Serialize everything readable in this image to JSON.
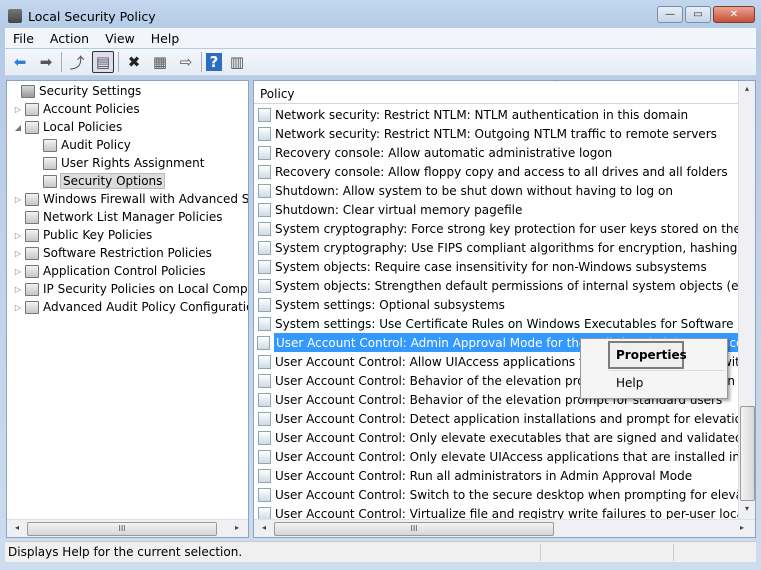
{
  "window": {
    "title": "Local Security Policy",
    "minimize": "—",
    "maximize": "▭",
    "close": "✕"
  },
  "menu": [
    "File",
    "Action",
    "View",
    "Help"
  ],
  "toolbar": [
    {
      "icon": "back-icon",
      "glyph": "⬅"
    },
    {
      "icon": "forward-icon",
      "glyph": "➡"
    },
    {
      "icon": "up-folder-icon",
      "glyph": "⤴"
    },
    {
      "icon": "show-hide-tree-icon",
      "glyph": "▤"
    },
    {
      "icon": "delete-icon",
      "glyph": "✖"
    },
    {
      "icon": "properties-icon",
      "glyph": "▦"
    },
    {
      "icon": "export-list-icon",
      "glyph": "⇨"
    },
    {
      "icon": "help-icon",
      "glyph": "?"
    },
    {
      "icon": "show-action-pane-icon",
      "glyph": "▥"
    }
  ],
  "tree": [
    {
      "label": "Security Settings",
      "level": 0,
      "expander": ""
    },
    {
      "label": "Account Policies",
      "level": 1,
      "expander": "▷"
    },
    {
      "label": "Local Policies",
      "level": 1,
      "expander": "◢"
    },
    {
      "label": "Audit Policy",
      "level": 2,
      "expander": ""
    },
    {
      "label": "User Rights Assignment",
      "level": 2,
      "expander": ""
    },
    {
      "label": "Security Options",
      "level": 2,
      "expander": "",
      "selected": true
    },
    {
      "label": "Windows Firewall with Advanced Security",
      "level": 1,
      "expander": "▷"
    },
    {
      "label": "Network List Manager Policies",
      "level": 1,
      "expander": ""
    },
    {
      "label": "Public Key Policies",
      "level": 1,
      "expander": "▷"
    },
    {
      "label": "Software Restriction Policies",
      "level": 1,
      "expander": "▷"
    },
    {
      "label": "Application Control Policies",
      "level": 1,
      "expander": "▷"
    },
    {
      "label": "IP Security Policies on Local Computer",
      "level": 1,
      "expander": "▷"
    },
    {
      "label": "Advanced Audit Policy Configuration",
      "level": 1,
      "expander": "▷"
    }
  ],
  "list": {
    "header": "Policy",
    "sort_indicator": "˄",
    "rows": [
      "Network security: Restrict NTLM: NTLM authentication in this domain",
      "Network security: Restrict NTLM: Outgoing NTLM traffic to remote servers",
      "Recovery console: Allow automatic administrative logon",
      "Recovery console: Allow floppy copy and access to all drives and all folders",
      "Shutdown: Allow system to be shut down without having to log on",
      "Shutdown: Clear virtual memory pagefile",
      "System cryptography: Force strong key protection for user keys stored on the computer",
      "System cryptography: Use FIPS compliant algorithms for encryption, hashing, and signing",
      "System objects: Require case insensitivity for non-Windows subsystems",
      "System objects: Strengthen default permissions of internal system objects (e.g. Symbolic Links)",
      "System settings: Optional subsystems",
      "System settings: Use Certificate Rules on Windows Executables for Software Restriction Policies",
      "User Account Control: Admin Approval Mode for the Built-in Administrator account",
      "User Account Control: Allow UIAccess applications to prompt for elevation without using the secure desktop",
      "User Account Control: Behavior of the elevation prompt for administrators in Admin Approval Mode",
      "User Account Control: Behavior of the elevation prompt for standard users",
      "User Account Control: Detect application installations and prompt for elevation",
      "User Account Control: Only elevate executables that are signed and validated",
      "User Account Control: Only elevate UIAccess applications that are installed in secure locations",
      "User Account Control: Run all administrators in Admin Approval Mode",
      "User Account Control: Switch to the secure desktop when prompting for elevation",
      "User Account Control: Virtualize file and registry write failures to per-user locations"
    ],
    "selected_index": 12
  },
  "context_menu": {
    "properties": "Properties",
    "help": "Help"
  },
  "scroll": {
    "grip": "III",
    "left": "◂",
    "right": "▸",
    "up": "▴",
    "down": "▾"
  },
  "status": "Displays Help for the current selection."
}
